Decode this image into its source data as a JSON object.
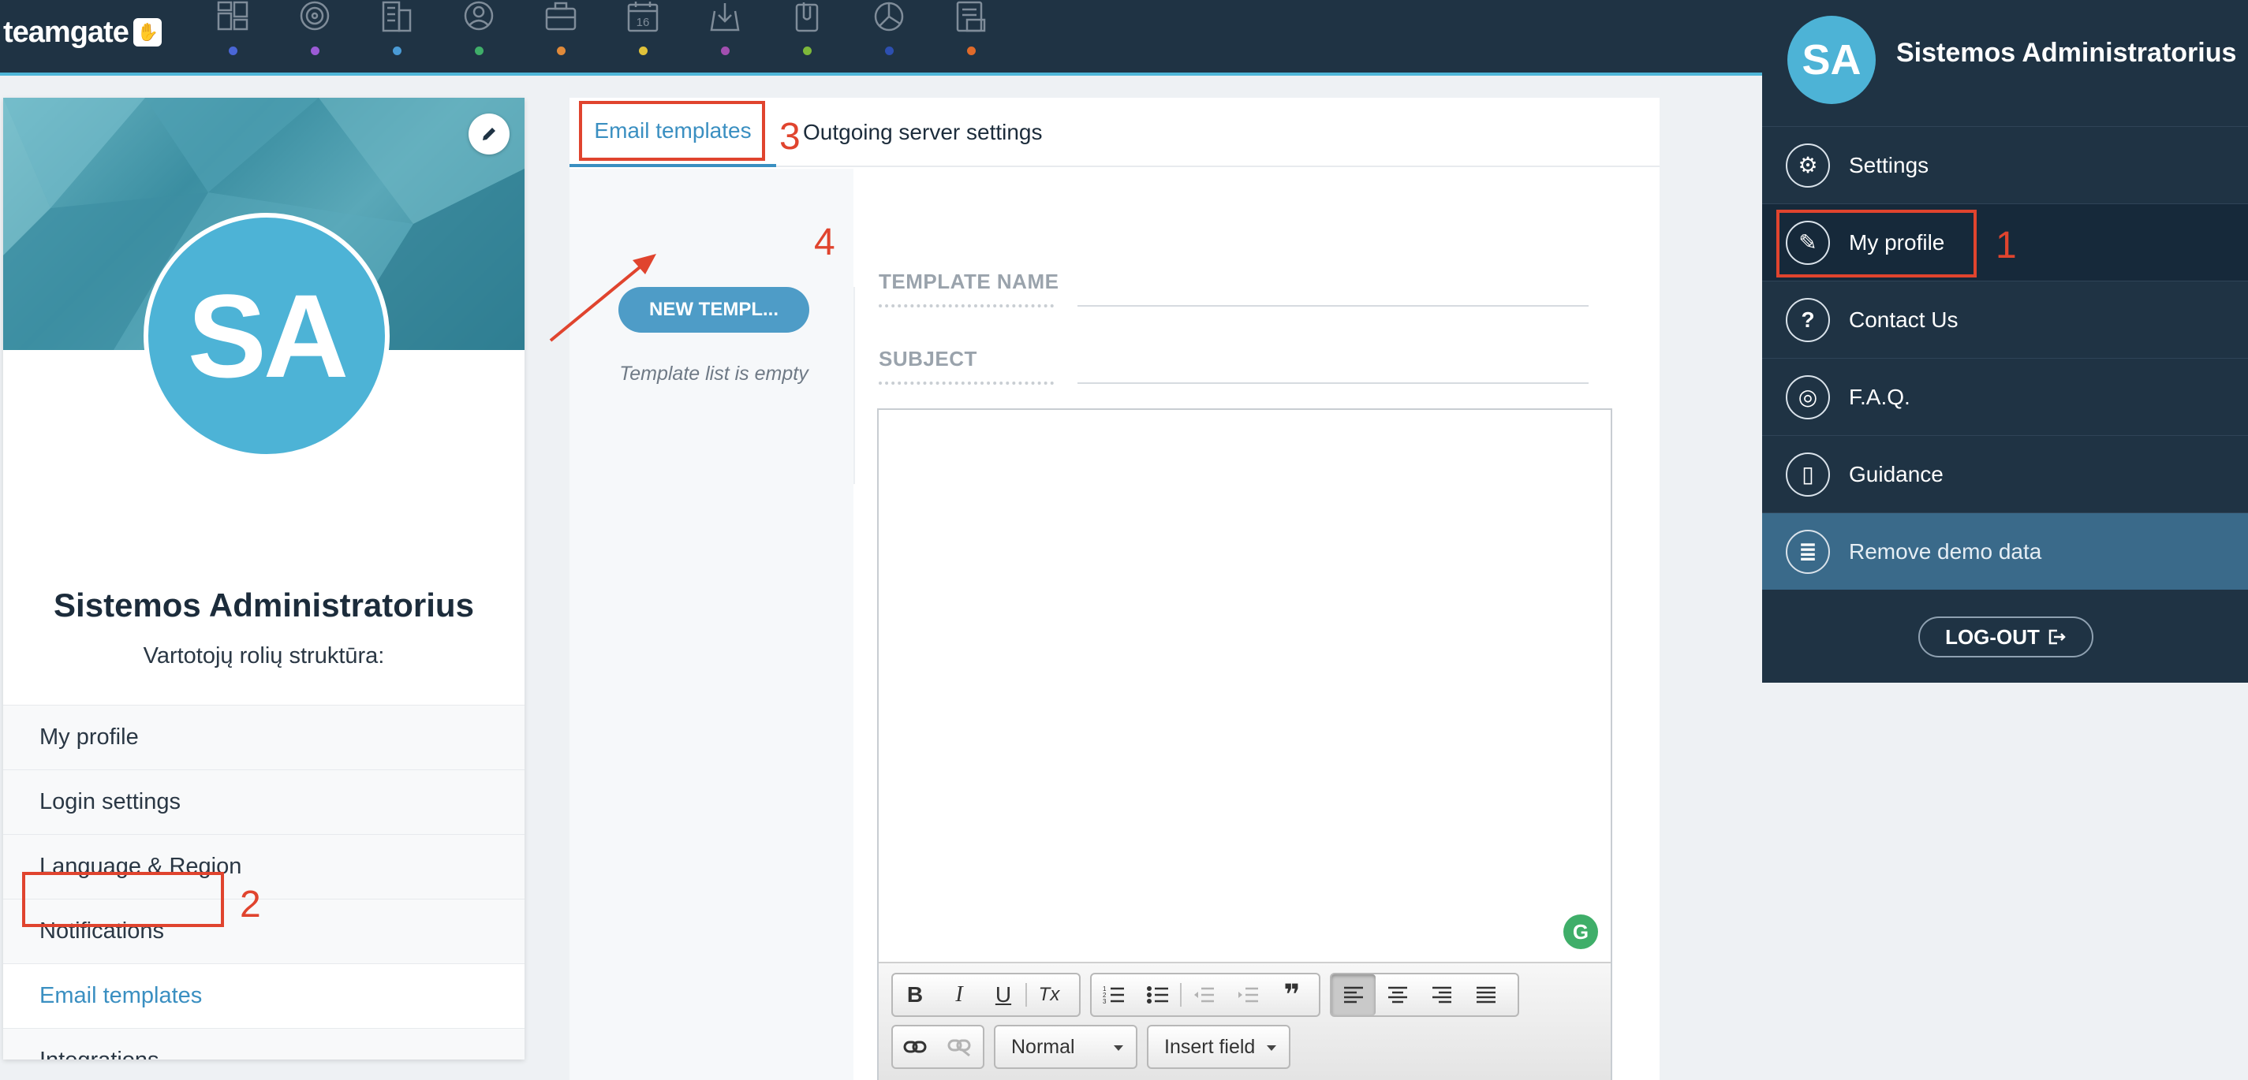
{
  "brand": {
    "logo_text": "teamgate",
    "logo_badge": "✋"
  },
  "nav": {
    "dot_colors": [
      "#4a66d6",
      "#9b5bd6",
      "#4a9bd6",
      "#3fae69",
      "#e08a3a",
      "#e0c23a",
      "#a24fb0",
      "#7db83a",
      "#2d4fb0",
      "#e06a2a"
    ],
    "icons": [
      "dashboard-icon",
      "target-icon",
      "building-icon",
      "contact-icon",
      "briefcase-icon",
      "calendar-icon",
      "download-icon",
      "paperclip-icon",
      "pie-chart-icon",
      "report-icon"
    ],
    "calendar_day": "16"
  },
  "profile": {
    "initials": "SA",
    "name": "Sistemos Administratorius",
    "role": "Vartotojų rolių struktūra:",
    "menu": [
      {
        "label": "My profile"
      },
      {
        "label": "Login settings"
      },
      {
        "label": "Language & Region"
      },
      {
        "label": "Notifications"
      },
      {
        "label": "Email templates"
      },
      {
        "label": "Integrations"
      }
    ]
  },
  "tabs": {
    "email_templates": "Email templates",
    "outgoing_server": "Outgoing server settings"
  },
  "templates": {
    "new_button": "NEW TEMPL...",
    "empty_text": "Template list is empty"
  },
  "form": {
    "template_name_label": "TEMPLATE NAME",
    "subject_label": "SUBJECT"
  },
  "editor": {
    "grammarly": "G",
    "toolbar": {
      "bold": "B",
      "italic": "I",
      "underline": "U",
      "clear": "Tx",
      "quote": "❞",
      "format_select": "Normal",
      "insert_field": "Insert field"
    }
  },
  "user_menu": {
    "initials": "SA",
    "name": "Sistemos Administratorius",
    "items": [
      {
        "label": "Settings",
        "icon": "gear-icon",
        "glyph": "⚙"
      },
      {
        "label": "My profile",
        "icon": "user-edit-icon",
        "glyph": "✎"
      },
      {
        "label": "Contact Us",
        "icon": "question-icon",
        "glyph": "?"
      },
      {
        "label": "F.A.Q.",
        "icon": "lifebuoy-icon",
        "glyph": "◎"
      },
      {
        "label": "Guidance",
        "icon": "book-icon",
        "glyph": "▯"
      },
      {
        "label": "Remove demo data",
        "icon": "database-icon",
        "glyph": "≣"
      }
    ],
    "logout": "LOG-OUT"
  },
  "annotations": {
    "n1": "1",
    "n2": "2",
    "n3": "3",
    "n4": "4",
    "color": "#e0442e"
  }
}
